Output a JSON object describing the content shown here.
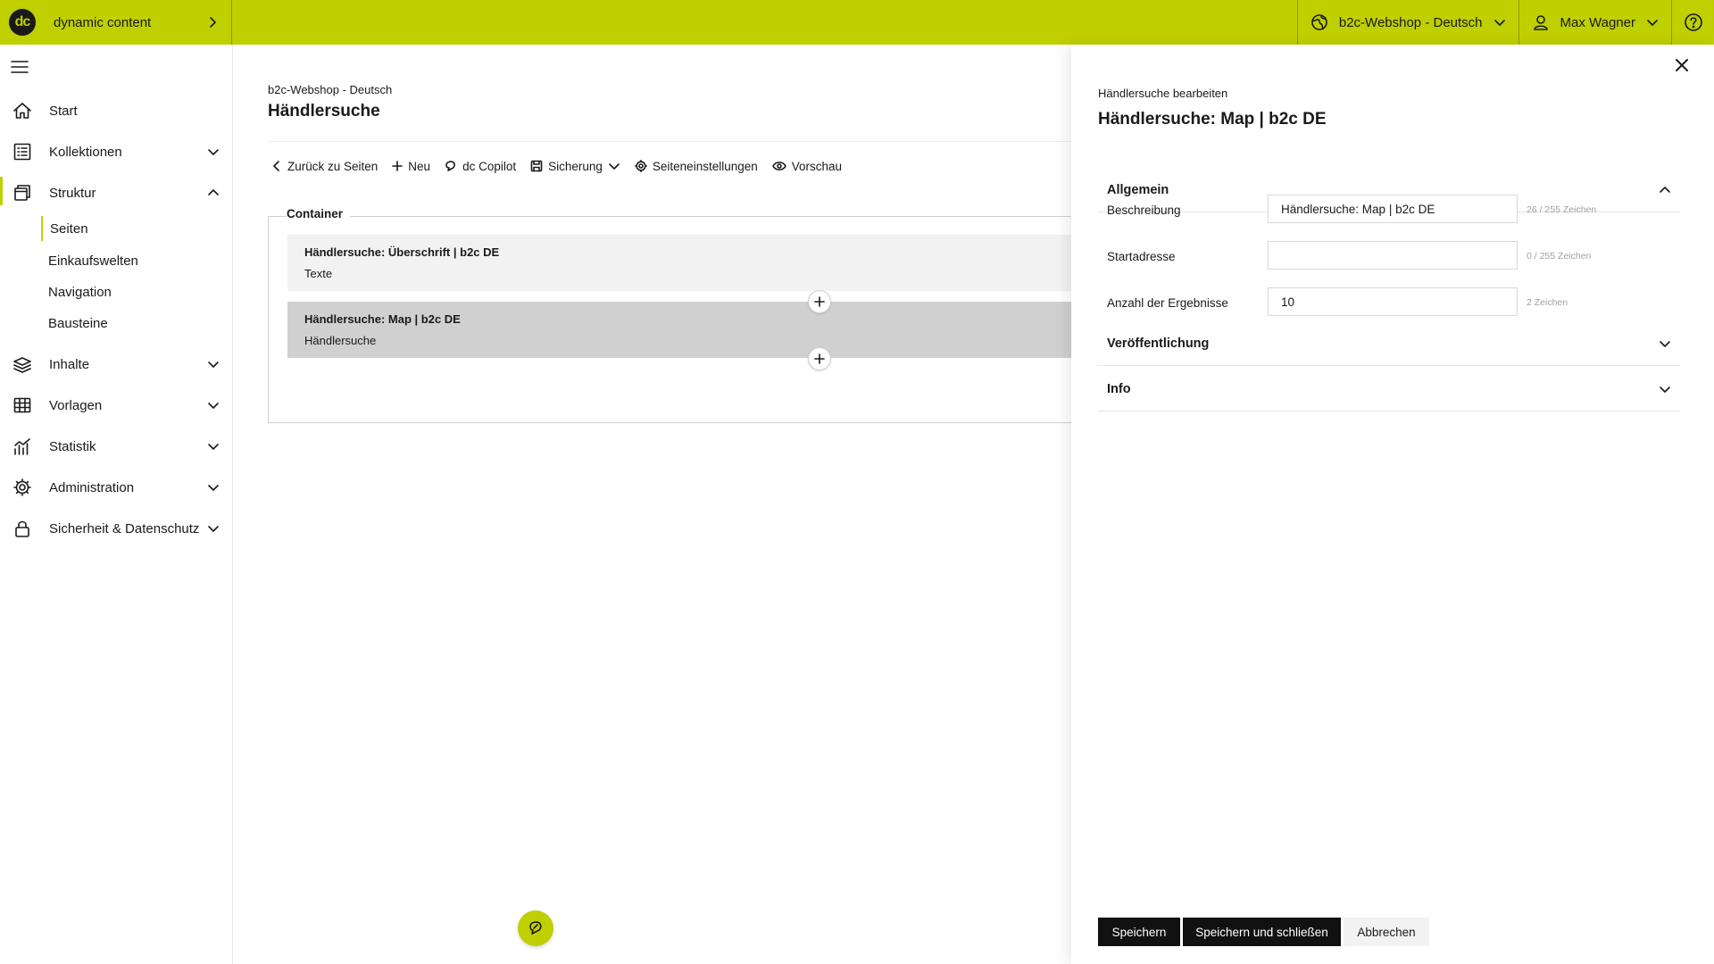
{
  "app": {
    "name": "dynamic content",
    "logo_text": "dc"
  },
  "topbar": {
    "site_selector": "b2c-Webshop - Deutsch",
    "user": "Max Wagner"
  },
  "sidebar": {
    "items": [
      {
        "label": "Start"
      },
      {
        "label": "Kollektionen"
      },
      {
        "label": "Struktur"
      },
      {
        "label": "Inhalte"
      },
      {
        "label": "Vorlagen"
      },
      {
        "label": "Statistik"
      },
      {
        "label": "Administration"
      },
      {
        "label": "Sicherheit & Datenschutz"
      }
    ],
    "struktur_sub": [
      {
        "label": "Seiten"
      },
      {
        "label": "Einkaufswelten"
      },
      {
        "label": "Navigation"
      },
      {
        "label": "Bausteine"
      }
    ]
  },
  "main": {
    "breadcrumb": "b2c-Webshop - Deutsch",
    "title": "Händlersuche",
    "toolbar": {
      "back": "Zurück zu Seiten",
      "new": "Neu",
      "copilot": "dc Copilot",
      "backup": "Sicherung",
      "settings": "Seiteneinstellungen",
      "preview": "Vorschau"
    },
    "container_label": "Container",
    "blocks": [
      {
        "title": "Händlersuche: Überschrift | b2c DE",
        "type": "Texte"
      },
      {
        "title": "Händlersuche: Map | b2c DE",
        "type": "Händlersuche"
      }
    ]
  },
  "panel": {
    "subtitle": "Händlersuche bearbeiten",
    "title": "Händlersuche: Map | b2c DE",
    "sections": {
      "general": "Allgemein",
      "publication": "Veröffentlichung",
      "info": "Info"
    },
    "fields": [
      {
        "label": "Beschreibung",
        "value": "Händlersuche: Map | b2c DE",
        "counter": "26 / 255 Zeichen"
      },
      {
        "label": "Startadresse",
        "value": "",
        "counter": "0 / 255 Zeichen"
      },
      {
        "label": "Anzahl der Ergebnisse",
        "value": "10",
        "counter": "2 Zeichen"
      }
    ],
    "buttons": {
      "save": "Speichern",
      "save_close": "Speichern und schließen",
      "cancel": "Abbrechen"
    }
  },
  "colors": {
    "accent": "#bfcf00",
    "dark": "#111111",
    "active_block": "#d0d0d0",
    "block": "#f2f2f2"
  }
}
